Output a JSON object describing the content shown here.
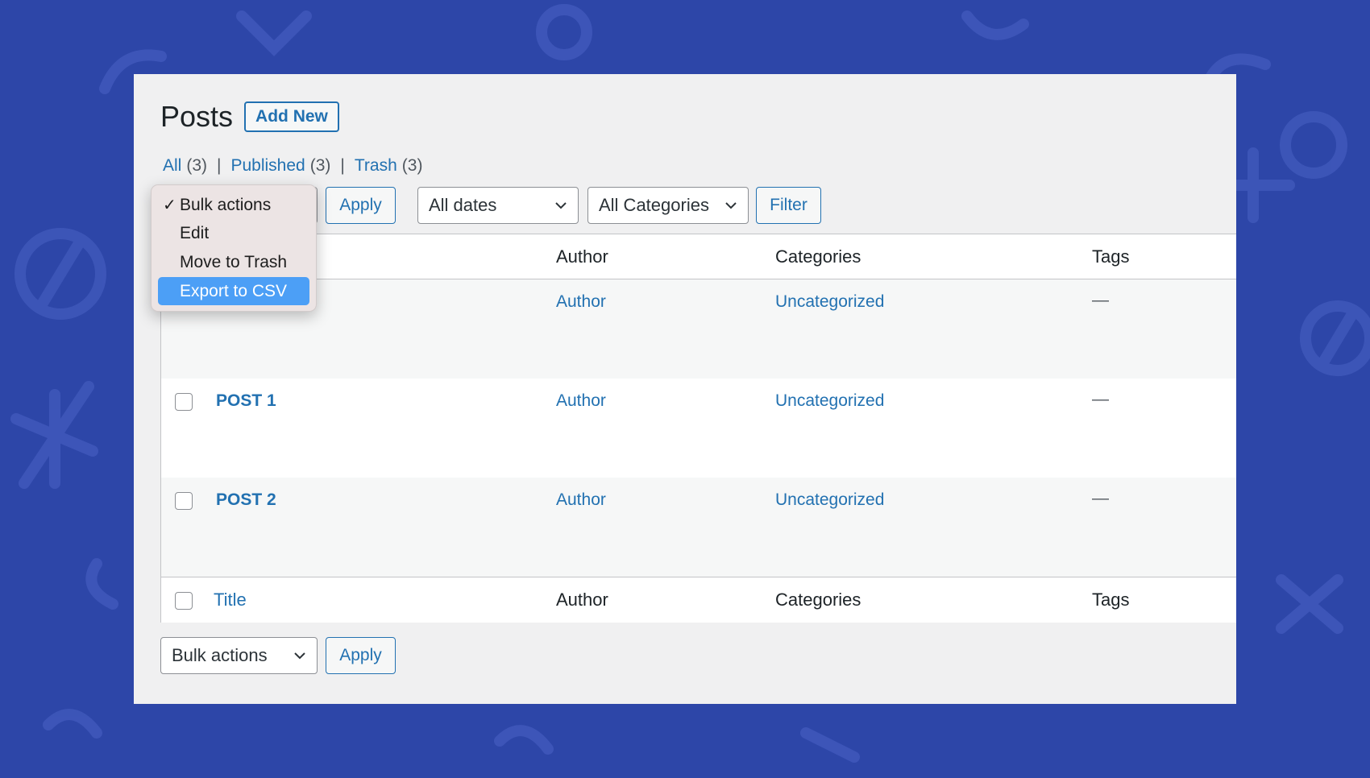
{
  "page": {
    "title": "Posts",
    "add_new_label": "Add New"
  },
  "filters": {
    "all_label": "All",
    "all_count": "(3)",
    "published_label": "Published",
    "published_count": "(3)",
    "trash_label": "Trash",
    "trash_count": "(3)",
    "separator": "|"
  },
  "toolbar_top": {
    "apply_label": "Apply",
    "dates_selected": "All dates",
    "categories_selected": "All Categories",
    "filter_label": "Filter"
  },
  "bulk_dropdown": {
    "check_glyph": "✓",
    "options": [
      {
        "label": "Bulk actions",
        "checked": true,
        "highlighted": false
      },
      {
        "label": "Edit",
        "checked": false,
        "highlighted": false
      },
      {
        "label": "Move to Trash",
        "checked": false,
        "highlighted": false
      },
      {
        "label": "Export to CSV",
        "checked": false,
        "highlighted": true
      }
    ]
  },
  "table": {
    "headers": {
      "title": "Title",
      "author": "Author",
      "categories": "Categories",
      "tags": "Tags"
    },
    "rows": [
      {
        "title": "",
        "author": "Author",
        "categories": "Uncategorized",
        "tags": "—"
      },
      {
        "title": "POST 1",
        "author": "Author",
        "categories": "Uncategorized",
        "tags": "—"
      },
      {
        "title": "POST 2",
        "author": "Author",
        "categories": "Uncategorized",
        "tags": "—"
      }
    ]
  },
  "toolbar_bottom": {
    "bulk_selected": "Bulk actions",
    "apply_label": "Apply"
  },
  "colors": {
    "background": "#2d46a8",
    "panel": "#f0f0f1",
    "link": "#2271b1",
    "highlight": "#4c9ff6"
  }
}
